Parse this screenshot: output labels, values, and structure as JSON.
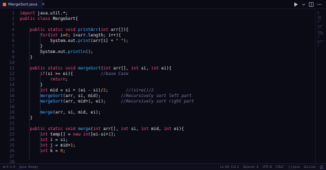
{
  "tab": {
    "filename": "MergeSort.java",
    "close_glyph": "×",
    "icon": "java-file-icon"
  },
  "toolbar": {
    "run_icon": "play-icon",
    "split_icon": "split-editor-icon",
    "more_icon": "more-icon"
  },
  "editor": {
    "line_numbers": [
      "1",
      "2",
      "3",
      "4",
      "5",
      "6",
      "7",
      "8",
      "9",
      "10",
      "11",
      "12",
      "13",
      "14",
      "15",
      "16",
      "17",
      "18",
      "19",
      "20",
      "21",
      "22",
      "23",
      "24",
      "25",
      "26",
      "27",
      "28"
    ],
    "lines": [
      [
        [
          "kw",
          "import"
        ],
        [
          "id",
          " java.util.*;"
        ]
      ],
      [
        [
          "kw",
          "public"
        ],
        [
          "id",
          " "
        ],
        [
          "kw",
          "class"
        ],
        [
          "id",
          " MergeSort{"
        ]
      ],
      [],
      [
        [
          "id",
          "    "
        ],
        [
          "kw",
          "public"
        ],
        [
          "id",
          " "
        ],
        [
          "kw",
          "static"
        ],
        [
          "id",
          " "
        ],
        [
          "kw",
          "void"
        ],
        [
          "id",
          " "
        ],
        [
          "fn",
          "printArr"
        ],
        [
          "op",
          "("
        ],
        [
          "kw",
          "int"
        ],
        [
          "id",
          " arr[]){"
        ]
      ],
      [
        [
          "id",
          "        "
        ],
        [
          "kw",
          "for"
        ],
        [
          "op",
          "("
        ],
        [
          "kw",
          "int"
        ],
        [
          "id",
          " i="
        ],
        [
          "num",
          "0"
        ],
        [
          "op",
          "; "
        ],
        [
          "id",
          "i<arr.length; i++){"
        ]
      ],
      [
        [
          "id",
          "            System.out."
        ],
        [
          "fn",
          "print"
        ],
        [
          "op",
          "("
        ],
        [
          "id",
          "arr[i] + "
        ],
        [
          "str",
          "\" \""
        ],
        [
          "op",
          ");"
        ]
      ],
      [
        [
          "id",
          "        }"
        ]
      ],
      [
        [
          "id",
          "        System.out."
        ],
        [
          "fn",
          "println"
        ],
        [
          "op",
          "();"
        ]
      ],
      [
        [
          "id",
          "    }"
        ]
      ],
      [],
      [
        [
          "id",
          "    "
        ],
        [
          "kw",
          "public"
        ],
        [
          "id",
          " "
        ],
        [
          "kw",
          "static"
        ],
        [
          "id",
          " "
        ],
        [
          "kw",
          "void"
        ],
        [
          "id",
          " "
        ],
        [
          "fn",
          "mergeSort"
        ],
        [
          "op",
          "("
        ],
        [
          "kw",
          "int"
        ],
        [
          "id",
          " arr[], "
        ],
        [
          "kw",
          "int"
        ],
        [
          "id",
          " si, "
        ],
        [
          "kw",
          "int"
        ],
        [
          "id",
          " ei){"
        ]
      ],
      [
        [
          "id",
          "        "
        ],
        [
          "kw",
          "if"
        ],
        [
          "op",
          "("
        ],
        [
          "id",
          "si >= ei){           "
        ],
        [
          "com",
          "//base Case"
        ]
      ],
      [
        [
          "id",
          "            "
        ],
        [
          "kw",
          "return"
        ],
        [
          "op",
          ";"
        ]
      ],
      [
        [
          "id",
          "        }"
        ]
      ],
      [
        [
          "id",
          "        "
        ],
        [
          "kw",
          "int"
        ],
        [
          "id",
          " mid = si + (ei - si)/"
        ],
        [
          "num",
          "2"
        ],
        [
          "op",
          ";"
        ],
        [
          "id",
          "       "
        ],
        [
          "com",
          "//(si+ei)/2"
        ]
      ],
      [
        [
          "id",
          "        "
        ],
        [
          "fn",
          "mergeSort"
        ],
        [
          "op",
          "("
        ],
        [
          "id",
          "arr, si, mid);        "
        ],
        [
          "com",
          "//Recursively sort left part"
        ]
      ],
      [
        [
          "id",
          "        "
        ],
        [
          "fn",
          "mergeSort"
        ],
        [
          "op",
          "("
        ],
        [
          "id",
          "arr, mid+"
        ],
        [
          "num",
          "1"
        ],
        [
          "id",
          ", ei);      "
        ],
        [
          "com",
          "//Recursively sort right part"
        ]
      ],
      [],
      [
        [
          "id",
          "        "
        ],
        [
          "fn",
          "merge"
        ],
        [
          "op",
          "("
        ],
        [
          "id",
          "arr, si, mid, ei);"
        ]
      ],
      [
        [
          "id",
          "    }"
        ]
      ],
      [],
      [
        [
          "id",
          "    "
        ],
        [
          "kw",
          "public"
        ],
        [
          "id",
          " "
        ],
        [
          "kw",
          "static"
        ],
        [
          "id",
          " "
        ],
        [
          "kw",
          "void"
        ],
        [
          "id",
          " "
        ],
        [
          "fn",
          "merge"
        ],
        [
          "op",
          "("
        ],
        [
          "kw",
          "int"
        ],
        [
          "id",
          " arr[], "
        ],
        [
          "kw",
          "int"
        ],
        [
          "id",
          " si, "
        ],
        [
          "kw",
          "int"
        ],
        [
          "id",
          " mid, "
        ],
        [
          "kw",
          "int"
        ],
        [
          "id",
          " ei){"
        ]
      ],
      [
        [
          "id",
          "        "
        ],
        [
          "kw",
          "int"
        ],
        [
          "id",
          " temp[] = "
        ],
        [
          "kw",
          "new"
        ],
        [
          "id",
          " "
        ],
        [
          "kw",
          "int"
        ],
        [
          "id",
          "[ei-si+"
        ],
        [
          "num",
          "1"
        ],
        [
          "id",
          "];"
        ]
      ],
      [
        [
          "id",
          "        "
        ],
        [
          "kw",
          "int"
        ],
        [
          "id",
          " i = si;"
        ]
      ],
      [
        [
          "id",
          "        "
        ],
        [
          "kw",
          "int"
        ],
        [
          "id",
          " j = mid+"
        ],
        [
          "num",
          "1"
        ],
        [
          "id",
          ";"
        ]
      ],
      [
        [
          "id",
          "        "
        ],
        [
          "kw",
          "int"
        ],
        [
          "id",
          " k = "
        ],
        [
          "num",
          "0"
        ],
        [
          "id",
          ";"
        ]
      ],
      [],
      [
        []
      ]
    ]
  },
  "statusbar": {
    "left": [
      {
        "icon": "remote-icon",
        "label": "⊗ 0 ⚠ 0"
      },
      {
        "icon": "java-status-icon",
        "label": "Java: Ready"
      }
    ],
    "right": [
      {
        "label": "Ln 46, Col 1"
      },
      {
        "label": "Spaces: 4"
      },
      {
        "label": "UTF-8"
      },
      {
        "label": "CRLF"
      },
      {
        "label": "{} Java"
      },
      {
        "label": "Go Live"
      },
      {
        "icon": "bell-icon",
        "label": ""
      }
    ]
  },
  "colors": {
    "background": "#0b0b16",
    "keyword": "#ff4f86",
    "function": "#38b6ff",
    "number": "#ff9a3c",
    "string": "#ffd166",
    "comment": "#7a7aa8"
  }
}
